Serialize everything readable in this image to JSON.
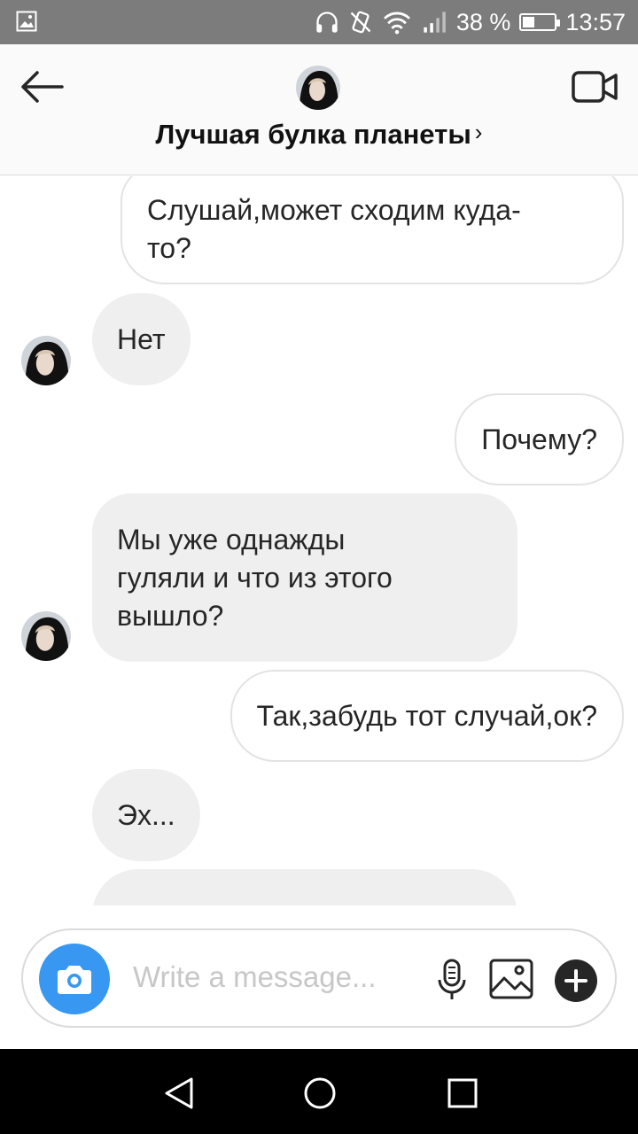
{
  "status_bar": {
    "battery_text": "38 %",
    "battery_level": 0.38,
    "time": "13:57",
    "icons": [
      "gallery-icon",
      "headphones-icon",
      "vibrate-icon",
      "wifi-icon",
      "signal-icon",
      "battery-icon"
    ]
  },
  "header": {
    "title": "Лучшая булка планеты",
    "chevron": "›",
    "icons": [
      "back-arrow-icon",
      "video-call-icon"
    ]
  },
  "messages": [
    {
      "side": "out",
      "lines": [
        "Слушай,может сходим куда-",
        "то?"
      ]
    },
    {
      "side": "in",
      "text": "Нет"
    },
    {
      "side": "out",
      "text": "Почему?"
    },
    {
      "side": "in",
      "lines": [
        "Мы уже однажды",
        "гуляли и что из этого",
        "вышло?"
      ]
    },
    {
      "side": "out",
      "text": "Так,забудь тот случай,ок?"
    },
    {
      "side": "in",
      "text": "Эх..."
    }
  ],
  "composer": {
    "placeholder": "Write a message...",
    "icons": [
      "camera-icon",
      "microphone-icon",
      "gallery-icon",
      "plus-icon"
    ]
  },
  "colors": {
    "accent": "#3897f0",
    "incoming_bubble": "#efefef",
    "status_bar": "#7c7c7c",
    "nav_bar": "#000000"
  }
}
